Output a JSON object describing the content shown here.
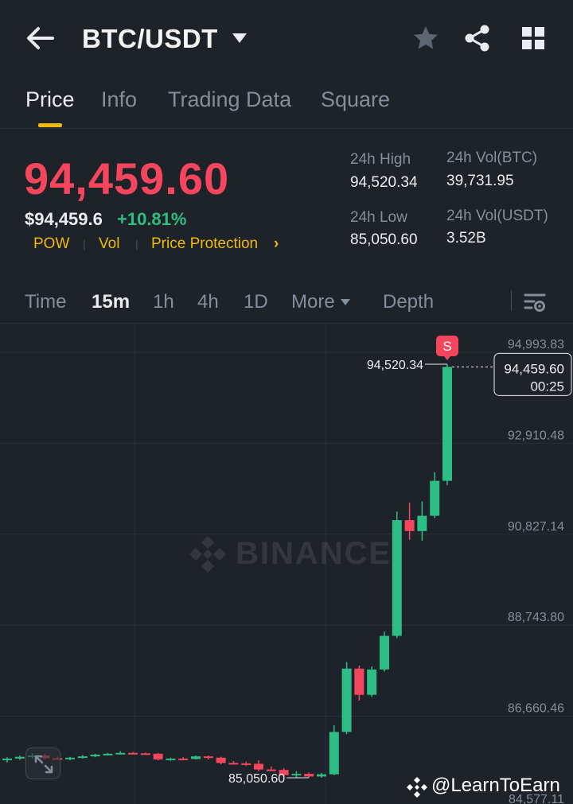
{
  "header": {
    "pair": "BTC/USDT",
    "icons": [
      "back-arrow-icon",
      "dropdown-caret-icon",
      "star-icon",
      "share-icon",
      "grid-icon"
    ]
  },
  "tabs": [
    {
      "label": "Price",
      "active": true
    },
    {
      "label": "Info",
      "active": false
    },
    {
      "label": "Trading Data",
      "active": false
    },
    {
      "label": "Square",
      "active": false
    }
  ],
  "price": {
    "last": "94,459.60",
    "usd": "$94,459.6",
    "change": "+10.81%",
    "tags": [
      "POW",
      "Vol",
      "Price Protection"
    ],
    "tag_arrow": "›"
  },
  "stats": {
    "high_label": "24h High",
    "high_value": "94,520.34",
    "vol_btc_label": "24h Vol(BTC)",
    "vol_btc_value": "39,731.95",
    "low_label": "24h Low",
    "low_value": "85,050.60",
    "vol_usdt_label": "24h Vol(USDT)",
    "vol_usdt_value": "3.52B"
  },
  "intervals": [
    {
      "label": "Time",
      "active": false
    },
    {
      "label": "15m",
      "active": true
    },
    {
      "label": "1h",
      "active": false
    },
    {
      "label": "4h",
      "active": false
    },
    {
      "label": "1D",
      "active": false
    },
    {
      "label": "More",
      "active": false
    },
    {
      "label": "Depth",
      "active": false
    }
  ],
  "colors": {
    "up": "#2ebd85",
    "down": "#f6465d",
    "accent": "#f0b90b",
    "background": "#1e2329"
  },
  "chart_data": {
    "type": "candlestick",
    "interval": "15m",
    "y_ticks": [
      "94,993.83",
      "92,910.48",
      "90,827.14",
      "88,743.80",
      "86,660.46",
      "84,577.11"
    ],
    "ylim": [
      84577.11,
      94993.83
    ],
    "high_marker": "94,520.34",
    "low_marker": "85,050.60",
    "current_price": "94,459.60",
    "countdown": "00:25",
    "signal_badge": "S",
    "candles": [
      {
        "o": 85470,
        "h": 85520,
        "l": 85400,
        "c": 85490
      },
      {
        "o": 85490,
        "h": 85560,
        "l": 85460,
        "c": 85530
      },
      {
        "o": 85530,
        "h": 85610,
        "l": 85490,
        "c": 85560
      },
      {
        "o": 85560,
        "h": 85590,
        "l": 85470,
        "c": 85500
      },
      {
        "o": 85500,
        "h": 85540,
        "l": 85460,
        "c": 85490
      },
      {
        "o": 85490,
        "h": 85530,
        "l": 85450,
        "c": 85510
      },
      {
        "o": 85510,
        "h": 85570,
        "l": 85490,
        "c": 85540
      },
      {
        "o": 85540,
        "h": 85600,
        "l": 85520,
        "c": 85580
      },
      {
        "o": 85580,
        "h": 85620,
        "l": 85560,
        "c": 85600
      },
      {
        "o": 85600,
        "h": 85660,
        "l": 85580,
        "c": 85620
      },
      {
        "o": 85620,
        "h": 85640,
        "l": 85590,
        "c": 85610
      },
      {
        "o": 85610,
        "h": 85630,
        "l": 85580,
        "c": 85600
      },
      {
        "o": 85600,
        "h": 85620,
        "l": 85450,
        "c": 85470
      },
      {
        "o": 85470,
        "h": 85510,
        "l": 85440,
        "c": 85490
      },
      {
        "o": 85490,
        "h": 85520,
        "l": 85460,
        "c": 85480
      },
      {
        "o": 85480,
        "h": 85560,
        "l": 85470,
        "c": 85540
      },
      {
        "o": 85540,
        "h": 85560,
        "l": 85470,
        "c": 85510
      },
      {
        "o": 85510,
        "h": 85530,
        "l": 85360,
        "c": 85390
      },
      {
        "o": 85390,
        "h": 85430,
        "l": 85350,
        "c": 85380
      },
      {
        "o": 85380,
        "h": 85420,
        "l": 85320,
        "c": 85370
      },
      {
        "o": 85370,
        "h": 85450,
        "l": 85200,
        "c": 85240
      },
      {
        "o": 85240,
        "h": 85310,
        "l": 85200,
        "c": 85230
      },
      {
        "o": 85230,
        "h": 85270,
        "l": 85070,
        "c": 85110
      },
      {
        "o": 85110,
        "h": 85200,
        "l": 85060,
        "c": 85140
      },
      {
        "o": 85140,
        "h": 85170,
        "l": 85050.6,
        "c": 85080
      },
      {
        "o": 85080,
        "h": 85160,
        "l": 85050.6,
        "c": 85130
      },
      {
        "o": 85130,
        "h": 86250,
        "l": 85110,
        "c": 86100
      },
      {
        "o": 86100,
        "h": 87700,
        "l": 86050,
        "c": 87550
      },
      {
        "o": 87550,
        "h": 87620,
        "l": 86820,
        "c": 86950
      },
      {
        "o": 86950,
        "h": 87600,
        "l": 86900,
        "c": 87530
      },
      {
        "o": 87530,
        "h": 88400,
        "l": 87480,
        "c": 88300
      },
      {
        "o": 88300,
        "h": 91150,
        "l": 88250,
        "c": 90950
      },
      {
        "o": 90950,
        "h": 91350,
        "l": 90500,
        "c": 90700
      },
      {
        "o": 90700,
        "h": 91380,
        "l": 90480,
        "c": 91050
      },
      {
        "o": 91050,
        "h": 92050,
        "l": 91000,
        "c": 91850
      },
      {
        "o": 91850,
        "h": 94520.34,
        "l": 91750,
        "c": 94459.6
      }
    ]
  },
  "watermark": "BINANCE",
  "credit": "@LearnToEarn"
}
